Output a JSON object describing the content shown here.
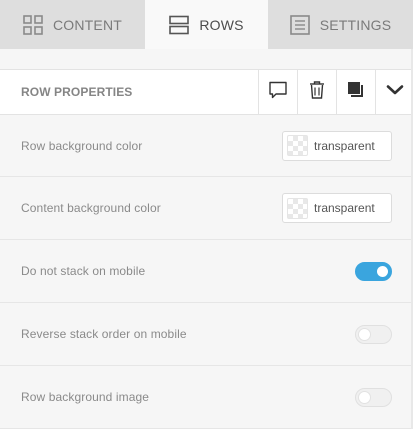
{
  "tabs": [
    {
      "label": "CONTENT",
      "icon": "grid-icon",
      "active": false
    },
    {
      "label": "ROWS",
      "icon": "rows-icon",
      "active": true
    },
    {
      "label": "SETTINGS",
      "icon": "settings-list-icon",
      "active": false
    }
  ],
  "panel": {
    "title": "ROW PROPERTIES",
    "actions": [
      "comment-icon",
      "trash-icon",
      "duplicate-icon",
      "chevron-down-icon"
    ]
  },
  "properties": [
    {
      "label": "Row background color",
      "type": "color",
      "value": "transparent"
    },
    {
      "label": "Content background color",
      "type": "color",
      "value": "transparent"
    },
    {
      "label": "Do not stack on mobile",
      "type": "toggle",
      "on": true
    },
    {
      "label": "Reverse stack order on mobile",
      "type": "toggle",
      "on": false
    },
    {
      "label": "Row background image",
      "type": "toggle",
      "on": false
    }
  ],
  "colors": {
    "accent": "#3aa5de",
    "tab_bg": "#dedede",
    "active_tab_bg": "#f9f9f9"
  }
}
